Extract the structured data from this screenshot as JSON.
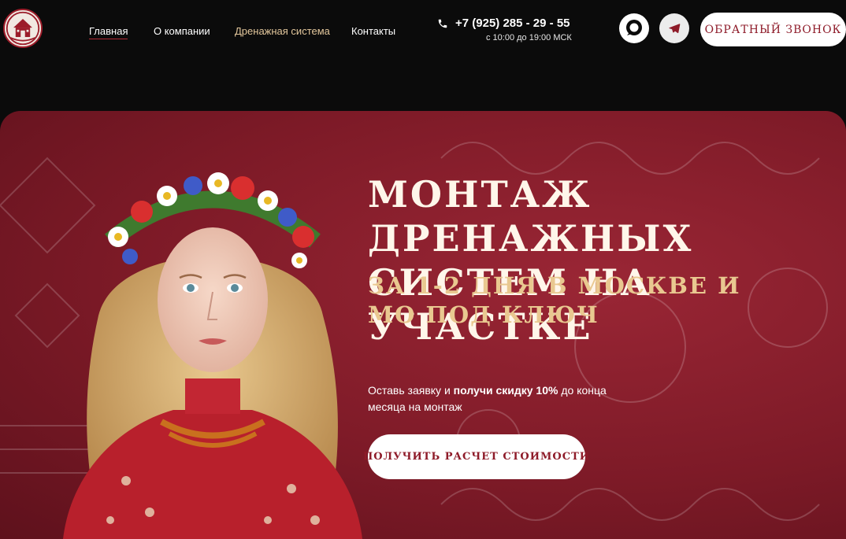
{
  "header": {
    "nav": [
      {
        "label": "Главная"
      },
      {
        "label": "О компании"
      },
      {
        "label": "Дренажная система"
      },
      {
        "label": "Контакты"
      }
    ],
    "phone": "+7 (925) 285 - 29 - 55",
    "hours": "с 10:00 до 19:00 МСК",
    "callback_label": "ОБРАТНЫЙ ЗВОНОК",
    "icons": {
      "chat": "chat-bubble-icon",
      "telegram": "telegram-icon",
      "phone": "phone-icon"
    }
  },
  "hero": {
    "title": "МОНТАЖ ДРЕНАЖНЫХ СИСТЕМ НА УЧАСТКЕ",
    "subtitle": "ЗА 1-2 ДНЯ В МОСКВЕ И МО ПОД КЛЮЧ",
    "text_before": "Оставь заявку и ",
    "text_bold": "получи скидку 10%",
    "text_after": " до конца месяца на монтаж",
    "cta_label": "ПОЛУЧИТЬ РАСЧЕТ СТОИМОСТИ"
  },
  "colors": {
    "accent": "#8e1b29",
    "gold": "#e9c890",
    "bg": "#0b0b0b"
  }
}
